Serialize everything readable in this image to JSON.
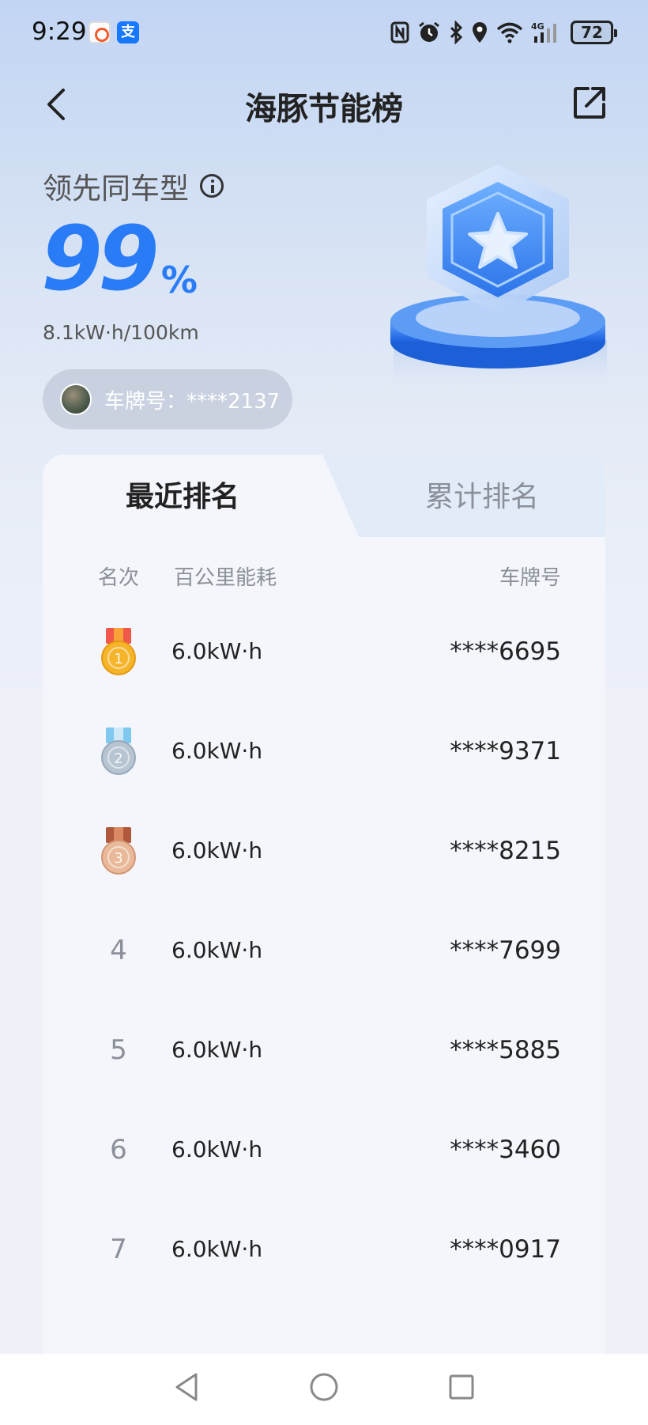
{
  "status_bar": {
    "time": "9:29",
    "battery": "72",
    "icons": [
      "nfc-icon",
      "alarm-icon",
      "bluetooth-icon",
      "location-icon",
      "wifi-icon",
      "signal-4g-icon",
      "battery-icon"
    ]
  },
  "header": {
    "title": "海豚节能榜"
  },
  "hero": {
    "lead_text": "领先同车型",
    "percent_value": "99",
    "percent_sign": "%",
    "energy": "8.1kW·h/100km",
    "plate": "车牌号：****2137"
  },
  "tabs": [
    {
      "label": "最近排名",
      "active": true
    },
    {
      "label": "累计排名",
      "active": false
    }
  ],
  "table": {
    "headers": {
      "rank": "名次",
      "energy": "百公里能耗",
      "plate": "车牌号"
    },
    "rows": [
      {
        "rank": "1",
        "medal": "gold",
        "energy": "6.0kW·h",
        "plate": "****6695"
      },
      {
        "rank": "2",
        "medal": "silver",
        "energy": "6.0kW·h",
        "plate": "****9371"
      },
      {
        "rank": "3",
        "medal": "bronze",
        "energy": "6.0kW·h",
        "plate": "****8215"
      },
      {
        "rank": "4",
        "medal": "",
        "energy": "6.0kW·h",
        "plate": "****7699"
      },
      {
        "rank": "5",
        "medal": "",
        "energy": "6.0kW·h",
        "plate": "****5885"
      },
      {
        "rank": "6",
        "medal": "",
        "energy": "6.0kW·h",
        "plate": "****3460"
      },
      {
        "rank": "7",
        "medal": "",
        "energy": "6.0kW·h",
        "plate": "****0917"
      }
    ]
  },
  "colors": {
    "accent": "#2a7cf6",
    "gold": "#f5b42a",
    "silver": "#aebccb",
    "bronze": "#e2ae8e"
  }
}
